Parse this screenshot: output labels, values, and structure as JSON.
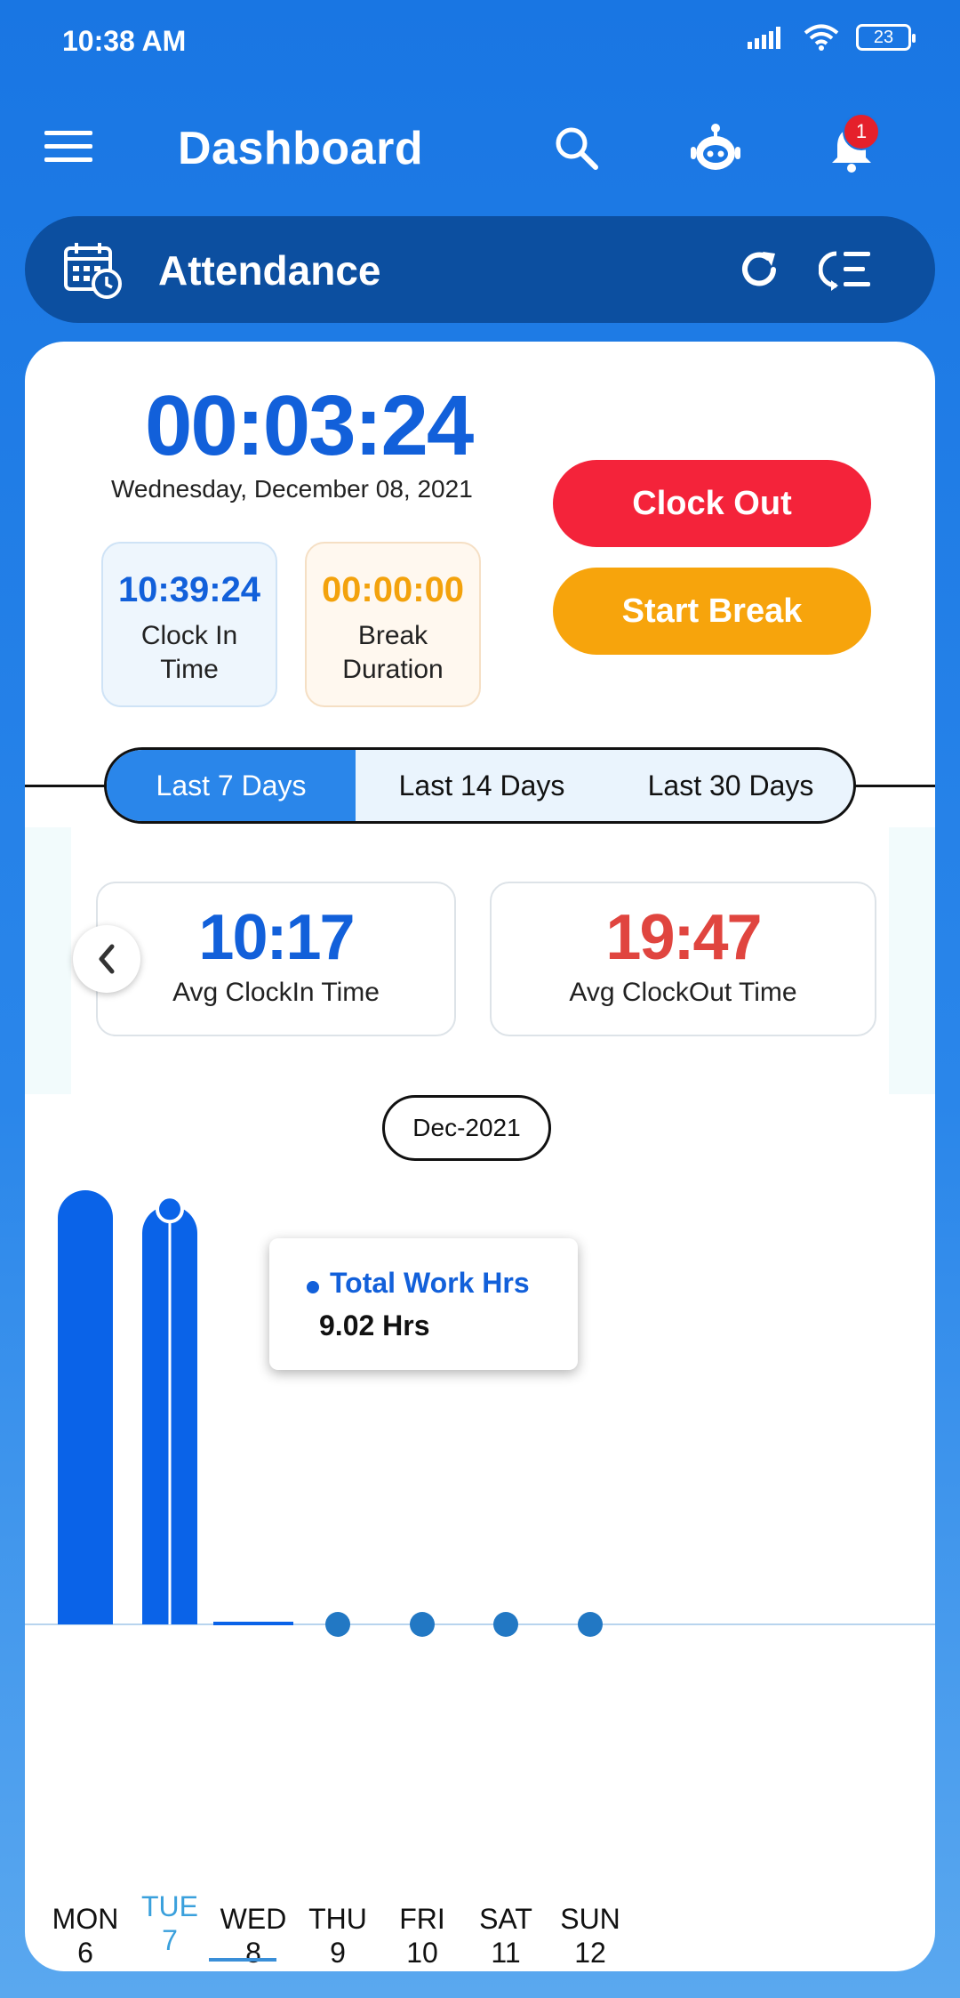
{
  "status_bar": {
    "time": "10:38 AM",
    "battery": "23"
  },
  "app_bar": {
    "title": "Dashboard",
    "notification_count": "1"
  },
  "section": {
    "title": "Attendance"
  },
  "timer": {
    "elapsed": "00:03:24",
    "date": "Wednesday, December 08, 2021"
  },
  "clock_in": {
    "value": "10:39:24",
    "label": "Clock In Time"
  },
  "break": {
    "value": "00:00:00",
    "label": "Break Duration"
  },
  "actions": {
    "clock_out": "Clock Out",
    "start_break": "Start Break"
  },
  "ranges": [
    {
      "label": "Last 7 Days",
      "active": true
    },
    {
      "label": "Last 14 Days",
      "active": false
    },
    {
      "label": "Last 30 Days",
      "active": false
    }
  ],
  "averages": {
    "clock_in": {
      "value": "10:17",
      "label": "Avg ClockIn Time"
    },
    "clock_out": {
      "value": "19:47",
      "label": "Avg ClockOut Time"
    }
  },
  "month": "Dec-2021",
  "tooltip": {
    "series": "Total Work Hrs",
    "value": "9.02 Hrs"
  },
  "colors": {
    "accent": "#1260da",
    "clock_out": "#f4233a",
    "break": "#f7a40c",
    "avg_out": "#e0453f"
  },
  "chart_data": {
    "type": "bar",
    "categories": [
      "MON 6",
      "TUE 7",
      "WED 8",
      "THU 9",
      "FRI 10",
      "SAT 11",
      "SUN 12"
    ],
    "days": [
      {
        "day": "MON",
        "date": "6"
      },
      {
        "day": "TUE",
        "date": "7"
      },
      {
        "day": "WED",
        "date": "8"
      },
      {
        "day": "THU",
        "date": "9"
      },
      {
        "day": "FRI",
        "date": "10"
      },
      {
        "day": "SAT",
        "date": "11"
      },
      {
        "day": "SUN",
        "date": "12"
      }
    ],
    "series": [
      {
        "name": "Total Work Hrs",
        "values": [
          9.35,
          9.02,
          0.06,
          0,
          0,
          0,
          0
        ]
      }
    ],
    "selected_index": 1,
    "ylim": [
      0,
      9.35
    ],
    "grid": false
  }
}
